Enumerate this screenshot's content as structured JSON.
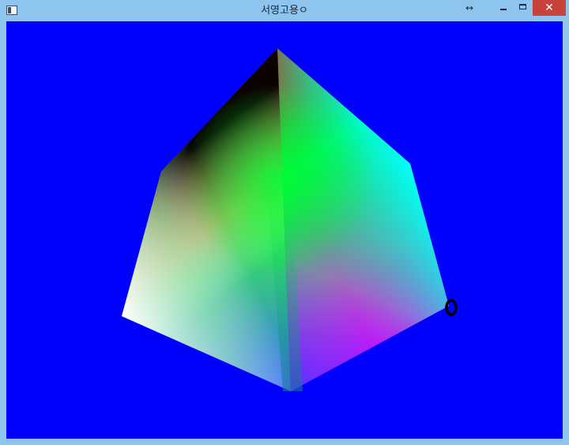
{
  "window": {
    "title": "서영고용ㅇ",
    "background_color": "#0000ff",
    "icons": {
      "app": "window-icon",
      "resize": "resize-arrows-icon",
      "minimize": "minimize-icon",
      "maximize": "maximize-icon",
      "close": "close-icon"
    },
    "resize_glyph": "↔",
    "close_glyph": "✕"
  },
  "scene": {
    "object": "rgb-color-cube",
    "cursor_icon": "ring-cursor-icon",
    "colors": {
      "red": "#ff0000",
      "green": "#00ff00",
      "cyan": "#00ffff",
      "magenta": "#ff00ff",
      "white": "#ffffff",
      "black": "#000000",
      "blue": "#0000ff"
    }
  }
}
